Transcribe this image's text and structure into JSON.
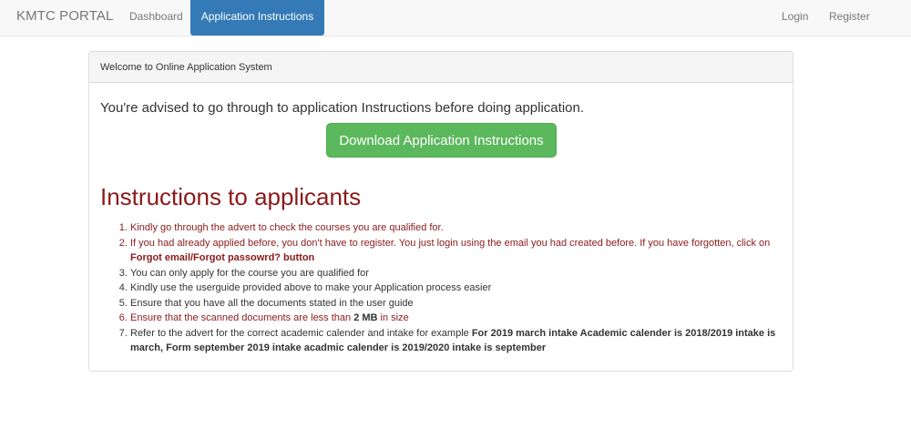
{
  "navbar": {
    "brand": "KMTC PORTAL",
    "links": {
      "dashboard": "Dashboard",
      "application_instructions": "Application Instructions",
      "login": "Login",
      "register": "Register"
    },
    "active_color": "#337ab7"
  },
  "panel": {
    "heading": "Welcome to Online Application System",
    "advice": "You're advised to go through to application Instructions before doing application.",
    "download_button": "Download Application Instructions",
    "button_color": "#5cb85c"
  },
  "instructions": {
    "title": "Instructions to applicants",
    "title_color": "#8b1a1a",
    "items": [
      {
        "text": "Kindly go through the advert to check the courses you are qualified for."
      },
      {
        "text": "If you had already applied before, you don't have to register. You just login using the email you had created before. If you have forgotten, click on ",
        "bold": "Forgot email/Forgot passowrd? button"
      },
      {
        "text": "You can only apply for the course you are qualified for"
      },
      {
        "text": "Kindly use the userguide provided above to make your Application process easier"
      },
      {
        "text": "Ensure that you have all the documents stated in the user guide"
      },
      {
        "text": "Ensure that the scanned documents are less than ",
        "bold": "2 MB",
        "after": " in size"
      },
      {
        "text": "Refer to the advert for the correct academic calender and intake for example ",
        "bold": "For 2019 march intake Academic calender is 2018/2019 intake is march, Form september 2019 intake acadmic calender is 2019/2020 intake is september"
      }
    ]
  }
}
